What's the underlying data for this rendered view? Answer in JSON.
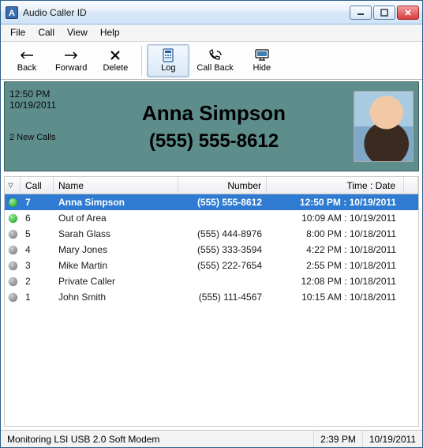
{
  "window": {
    "title": "Audio Caller ID",
    "app_icon_letter": "A"
  },
  "menu": {
    "file": "File",
    "call": "Call",
    "view": "View",
    "help": "Help"
  },
  "toolbar": {
    "back": "Back",
    "forward": "Forward",
    "delete": "Delete",
    "log": "Log",
    "callback": "Call Back",
    "hide": "Hide"
  },
  "caller_panel": {
    "time": "12:50 PM",
    "date": "10/19/2011",
    "new_calls": "2 New Calls",
    "name": "Anna Simpson",
    "number": "(555) 555-8612"
  },
  "columns": {
    "sort_glyph": "▽",
    "call": "Call",
    "name": "Name",
    "number": "Number",
    "timedate": "Time : Date"
  },
  "rows": [
    {
      "status": "green",
      "call": "7",
      "name": "Anna Simpson",
      "number": "(555) 555-8612",
      "time": "12:50 PM",
      "date": "10/19/2011",
      "selected": true
    },
    {
      "status": "green",
      "call": "6",
      "name": "Out of Area",
      "number": "",
      "time": "10:09 AM",
      "date": "10/19/2011",
      "selected": false
    },
    {
      "status": "grey",
      "call": "5",
      "name": "Sarah Glass",
      "number": "(555) 444-8976",
      "time": "8:00 PM",
      "date": "10/18/2011",
      "selected": false
    },
    {
      "status": "grey",
      "call": "4",
      "name": "Mary Jones",
      "number": "(555) 333-3594",
      "time": "4:22 PM",
      "date": "10/18/2011",
      "selected": false
    },
    {
      "status": "grey",
      "call": "3",
      "name": "Mike Martin",
      "number": "(555) 222-7654",
      "time": "2:55 PM",
      "date": "10/18/2011",
      "selected": false
    },
    {
      "status": "grey",
      "call": "2",
      "name": "Private Caller",
      "number": "",
      "time": "12:08 PM",
      "date": "10/18/2011",
      "selected": false
    },
    {
      "status": "grey",
      "call": "1",
      "name": "John Smith",
      "number": "(555) 111-4567",
      "time": "10:15 AM",
      "date": "10/18/2011",
      "selected": false
    }
  ],
  "statusbar": {
    "monitoring": "Monitoring LSI USB 2.0 Soft Modem",
    "time": "2:39 PM",
    "date": "10/19/2011"
  }
}
